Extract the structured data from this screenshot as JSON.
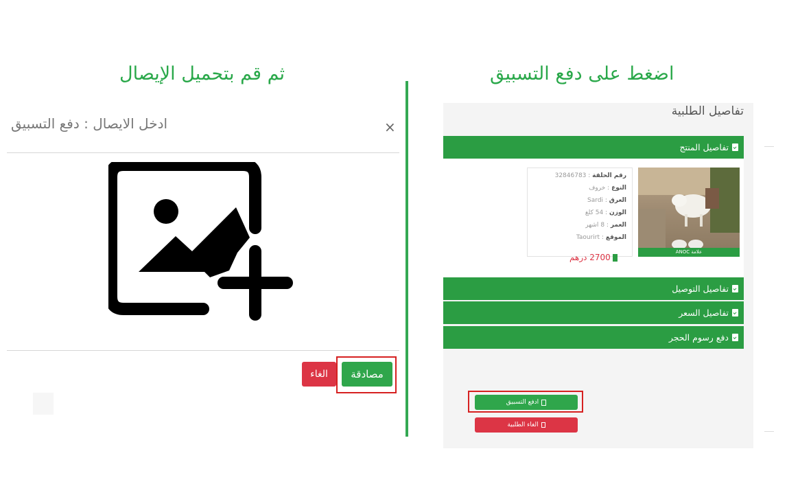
{
  "headings": {
    "left": "ثم قم بتحميل الإيصال",
    "right": "اضغط على دفع التسبيق"
  },
  "modal": {
    "title": "ادخل الايصال : دفع التسبيق",
    "close": "×",
    "upload_icon": "add-image-icon",
    "confirm_label": "مصادقة",
    "cancel_label": "الغاء"
  },
  "order": {
    "title": "تفاصيل الطلبية",
    "sections": {
      "product": "تفاصيل المنتج",
      "delivery": "تفاصيل التوصيل",
      "price": "تفاصيل السعر",
      "quarantine": "دفع رسوم الحجر"
    },
    "product": {
      "rows": [
        {
          "label": "رقم الحلقة",
          "value": "32846783"
        },
        {
          "label": "النوع",
          "value": "خروف"
        },
        {
          "label": "العرق",
          "value": "Sardi"
        },
        {
          "label": "الوزن",
          "value": "54 كلغ"
        },
        {
          "label": "العمر",
          "value": "8 اشهر"
        },
        {
          "label": "الموقع",
          "value": "Taourirt"
        }
      ],
      "badge": "علامة ANOC",
      "price": "2700 درهم"
    },
    "pay_label": "ادفع التسبيق",
    "cancel_order_label": "الغاء الطلبية"
  },
  "colors": {
    "accent_green": "#2aa84a",
    "bar_green": "#2b9d43",
    "danger_red": "#dc3545",
    "highlight_red": "#d62020"
  }
}
